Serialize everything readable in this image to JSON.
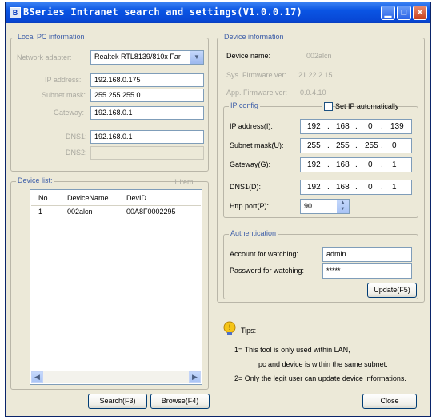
{
  "window": {
    "title": "BSeries Intranet search and settings(V1.0.0.17)",
    "app_icon": "app-icon",
    "controls": [
      "minimize-icon",
      "maximize-icon",
      "close-icon"
    ]
  },
  "local_pc": {
    "legend": "Local PC information",
    "network_adapter_label": "Network adapter:",
    "network_adapter_value": "Realtek RTL8139/810x Far",
    "ip_label": "IP address:",
    "ip_value": "192.168.0.175",
    "subnet_label": "Subnet mask:",
    "subnet_value": "255.255.255.0",
    "gateway_label": "Gateway:",
    "gateway_value": "192.168.0.1",
    "dns1_label": "DNS1:",
    "dns1_value": "192.168.0.1",
    "dns2_label": "DNS2:",
    "dns2_value": ""
  },
  "device_list": {
    "legend": "Device list:",
    "count": "1 item",
    "columns": [
      "No.",
      "DeviceName",
      "DevID"
    ],
    "rows": [
      {
        "no": "1",
        "name": "002alcn",
        "id": "00A8F0002295"
      }
    ]
  },
  "device_info": {
    "legend": "Device information",
    "name_label": "Device name:",
    "name_value": "002alcn",
    "sys_fw_label": "Sys. Firmware ver:",
    "sys_fw_value": "21.22.2.15",
    "app_fw_label": "App. Firmware ver:",
    "app_fw_value": "0.0.4.10"
  },
  "ip_config": {
    "legend": "IP config",
    "auto_label": "Set IP automatically",
    "auto_checked": false,
    "ip_label": "IP address(I):",
    "ip": [
      "192",
      "168",
      "0",
      "139"
    ],
    "mask_label": "Subnet mask(U):",
    "mask": [
      "255",
      "255",
      "255",
      "0"
    ],
    "gateway_label": "Gateway(G):",
    "gateway": [
      "192",
      "168",
      "0",
      "1"
    ],
    "dns_label": "DNS1(D):",
    "dns": [
      "192",
      "168",
      "0",
      "1"
    ],
    "port_label": "Http port(P):",
    "port_value": "90"
  },
  "auth": {
    "legend": "Authentication",
    "account_label": "Account for watching:",
    "account_value": "admin",
    "password_label": "Password for watching:",
    "password_value": "*****",
    "update_button": "Update(F5)"
  },
  "tips": {
    "icon": "tip-icon",
    "title": "Tips:",
    "line1": "1= This tool is only used within LAN,",
    "line2": "pc and device is within the same subnet.",
    "line3": "2= Only the legit user can update  device informations."
  },
  "buttons": {
    "search": "Search(F3)",
    "browse": "Browse(F4)",
    "close": "Close"
  }
}
